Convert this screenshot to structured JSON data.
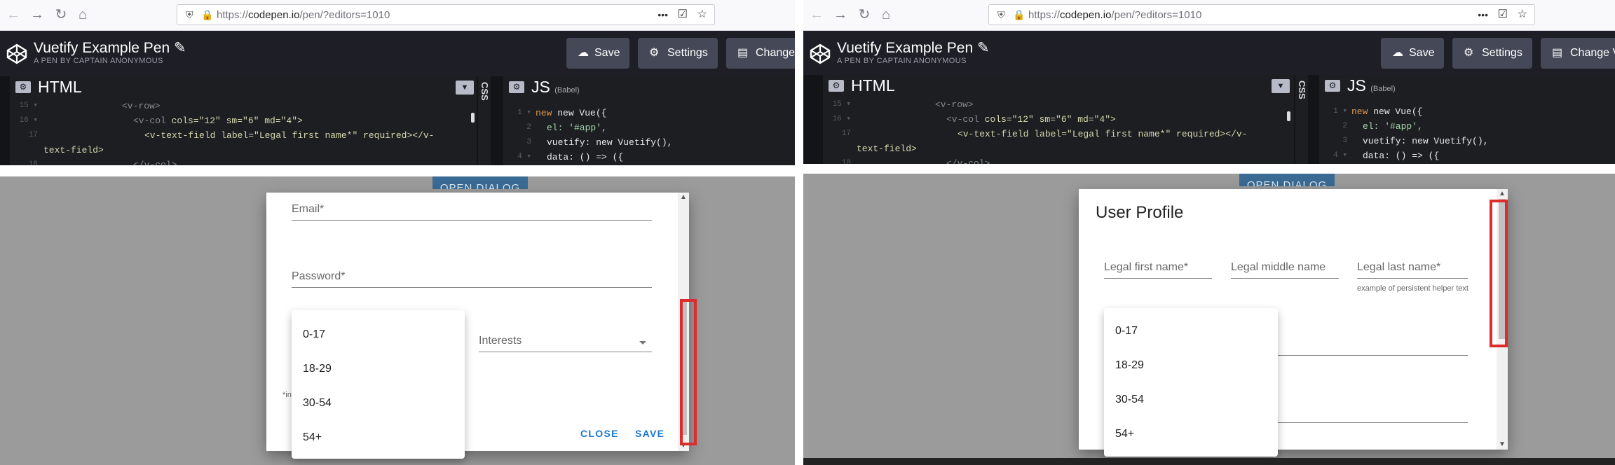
{
  "browser": {
    "url_prefix": "https://",
    "url_host": "codepen.io",
    "url_path": "/pen/?editors=1010",
    "back_icon": "arrow-left",
    "forward_icon": "arrow-right",
    "reload_icon": "reload",
    "home_icon": "home",
    "more_glyph": "•••"
  },
  "codepen": {
    "pen_title": "Vuetify Example Pen",
    "pen_subtitle": "A PEN BY CAPTAIN ANONYMOUS",
    "save_label": "Save",
    "settings_label": "Settings",
    "change_view_label": "Change V",
    "html_title": "HTML",
    "css_tab": "CSS",
    "js_title": "JS",
    "js_subtitle": "(Babel)"
  },
  "html_code": {
    "line_a": "<v-row>",
    "line_b_tag": "<v-col ",
    "line_b_attrs": "cols=\"12\" sm=\"6\" md=\"4\">",
    "line_c": "<v-text-field label=\"Legal first name*\" required></v-",
    "line_d": "text-field>",
    "line_e": "</v-col>"
  },
  "js_code": {
    "line_1": "new Vue({",
    "line_2": "el: '#app',",
    "line_3": "vuetify: new Vuetify(),",
    "line_4": "data: () => ({"
  },
  "page": {
    "open_dialog_label": "OPEN DIALOG"
  },
  "left_dialog": {
    "email_label": "Email*",
    "password_label": "Password*",
    "interests_label": "Interests",
    "required_hint": "*in",
    "close_label": "CLOSE",
    "save_label": "SAVE"
  },
  "right_dialog": {
    "title": "User Profile",
    "first_name_label": "Legal first name*",
    "middle_name_label": "Legal middle name",
    "last_name_label": "Legal last name*",
    "last_name_hint": "example of persistent helper text"
  },
  "age_menu": [
    "0-17",
    "18-29",
    "30-54",
    "54+"
  ],
  "colors": {
    "codepen_header": "#1e1f26",
    "overlay": "#9b9b9b",
    "highlight_box": "#dd2c2c",
    "button_primary": "#1976d2"
  }
}
